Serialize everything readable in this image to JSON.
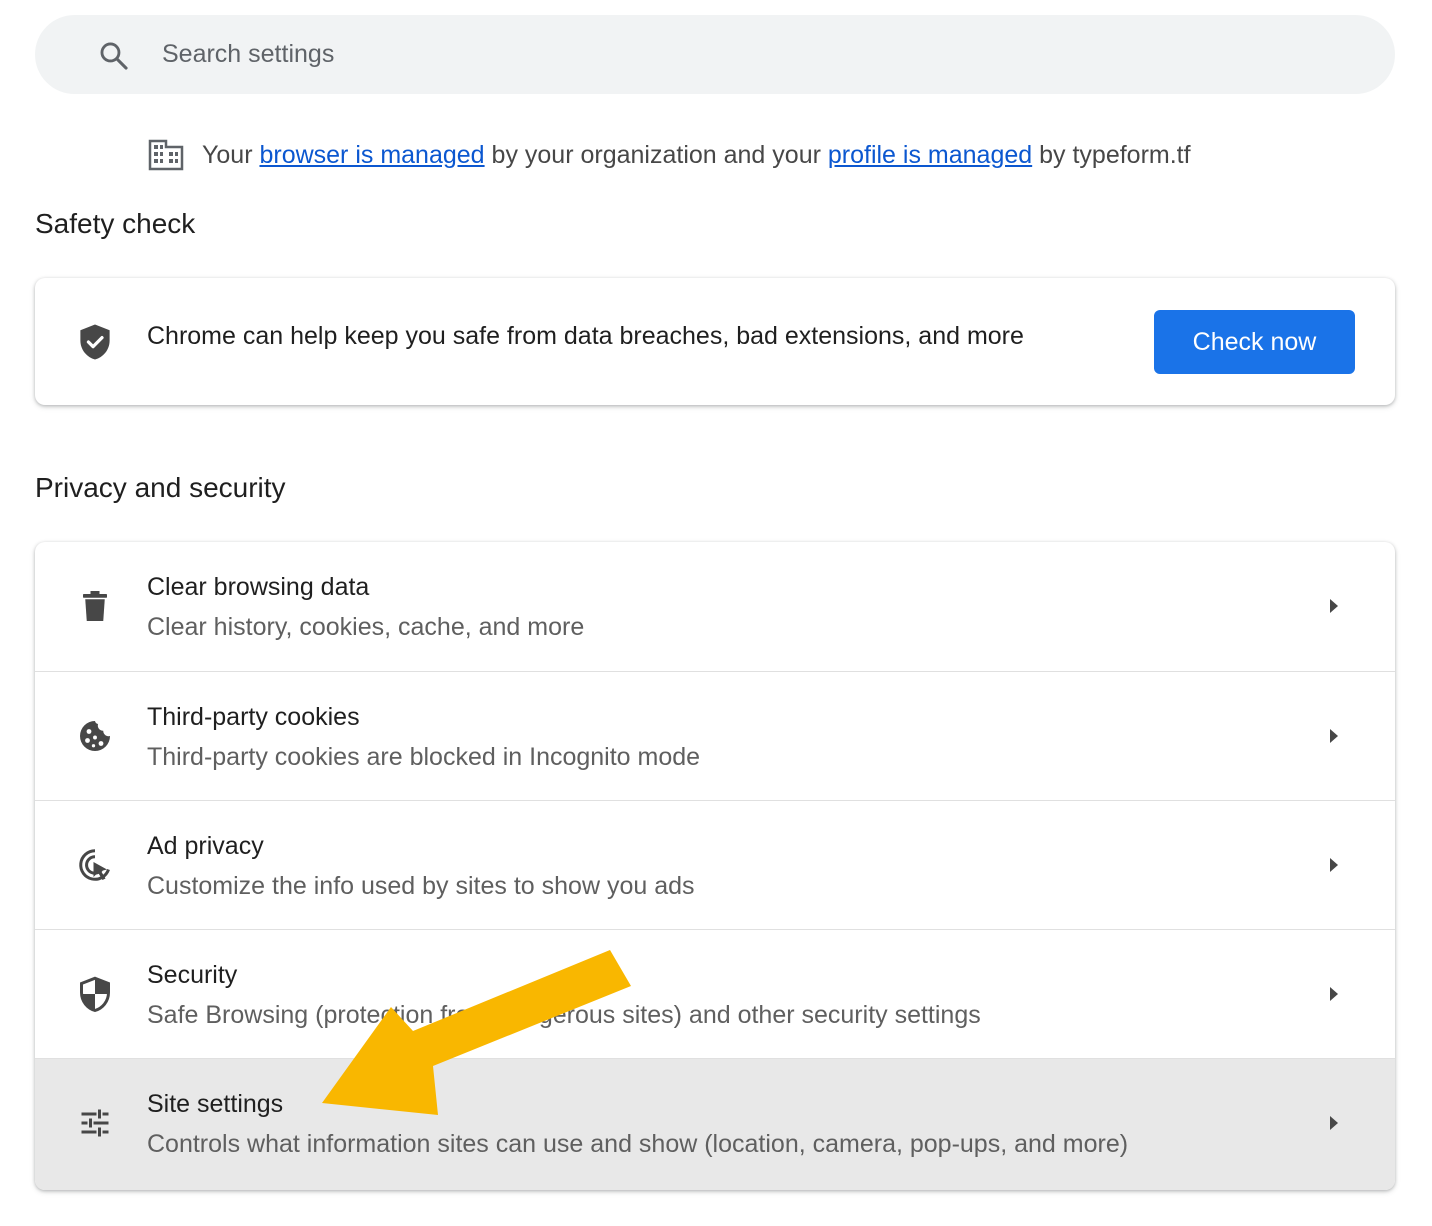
{
  "search": {
    "placeholder": "Search settings"
  },
  "managed_notice": {
    "prefix": "Your",
    "browser_link": "browser is managed",
    "middle": "by your organization and your",
    "profile_link": "profile is managed",
    "suffix": "by typeform.tf"
  },
  "safety_check": {
    "title": "Safety check",
    "message": "Chrome can help keep you safe from data breaches, bad extensions, and more",
    "button_label": "Check now"
  },
  "privacy": {
    "title": "Privacy and security",
    "items": [
      {
        "title": "Clear browsing data",
        "subtitle": "Clear history, cookies, cache, and more",
        "icon": "trash-icon"
      },
      {
        "title": "Third-party cookies",
        "subtitle": "Third-party cookies are blocked in Incognito mode",
        "icon": "cookie-icon"
      },
      {
        "title": "Ad privacy",
        "subtitle": "Customize the info used by sites to show you ads",
        "icon": "ad-privacy-icon"
      },
      {
        "title": "Security",
        "subtitle": "Safe Browsing (protection from dangerous sites) and other security settings",
        "icon": "security-shield-icon"
      },
      {
        "title": "Site settings",
        "subtitle": "Controls what information sites can use and show (location, camera, pop-ups, and more)",
        "icon": "tune-sliders-icon"
      }
    ]
  },
  "colors": {
    "accent": "#1a73e8",
    "link": "#0b57d0",
    "highlight_row": "#e8e8e8",
    "annotation_arrow": "#f9b700"
  }
}
